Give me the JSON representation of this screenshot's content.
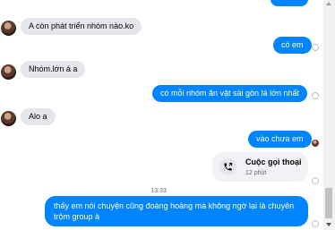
{
  "messages": {
    "m1": "A còn phát triển nhóm nào.ko",
    "m2": "có em",
    "m3": "Nhóm.lớn á a",
    "m4": "có mỗi nhóm ăn vặt sài gòn lá lớn nhất",
    "m5": "Alo a",
    "m6": "vào chưa em",
    "m7": "thấy em nói chuyện cũng đoàng hoàng mà không ngờ lại là chuyên trộm group à"
  },
  "call": {
    "title": "Cuộc gọi thoại",
    "duration": "12 phút"
  },
  "timestamp": "13:33",
  "colors": {
    "outgoing": "#0084ff",
    "incoming": "#e4e6eb",
    "call_card": "#f0f2f5"
  },
  "icons": {
    "call": "phone-icon"
  }
}
